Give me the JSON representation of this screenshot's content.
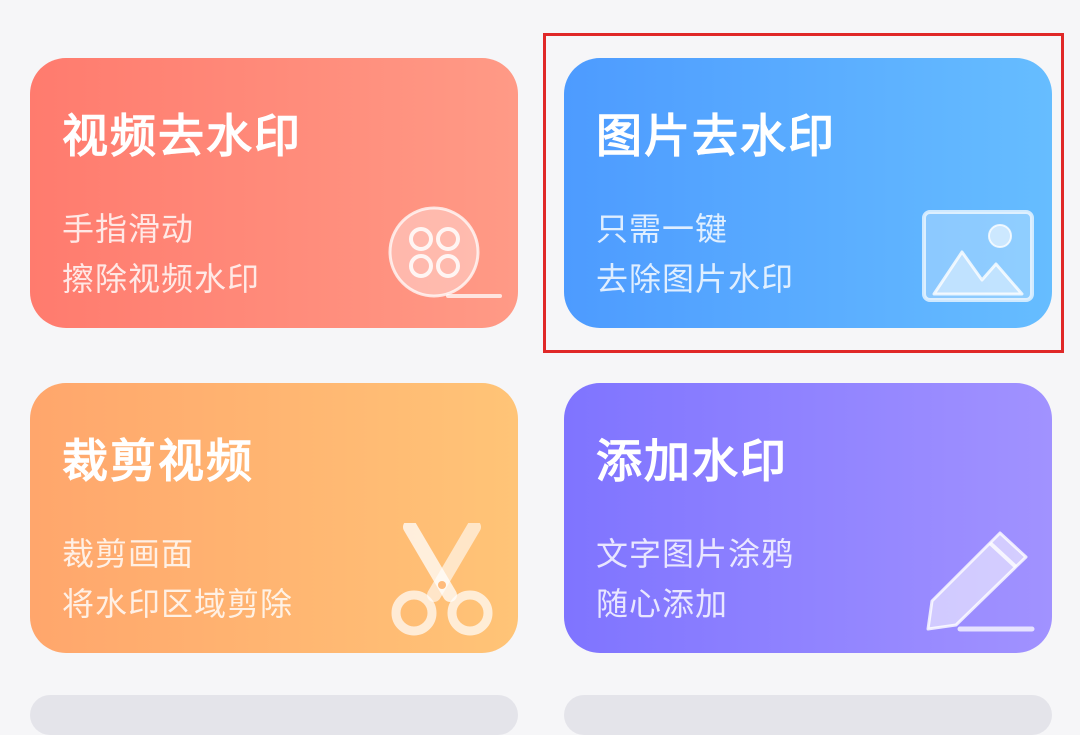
{
  "cards": [
    {
      "title": "视频去水印",
      "line1": "手指滑动",
      "line2": "擦除视频水印",
      "icon": "film-reel-icon",
      "colors": [
        "#ff7b6e",
        "#ff9a86"
      ]
    },
    {
      "title": "图片去水印",
      "line1": "只需一键",
      "line2": "去除图片水印",
      "icon": "image-icon",
      "colors": [
        "#4d9bff",
        "#66bdff"
      ]
    },
    {
      "title": "裁剪视频",
      "line1": "裁剪画面",
      "line2": "将水印区域剪除",
      "icon": "scissors-icon",
      "colors": [
        "#ffa66c",
        "#ffc477"
      ]
    },
    {
      "title": "添加水印",
      "line1": "文字图片涂鸦",
      "line2": "随心添加",
      "icon": "pencil-icon",
      "colors": [
        "#7f74ff",
        "#a192ff"
      ]
    }
  ],
  "highlight": {
    "color": "#e02828",
    "target": "图片去水印"
  }
}
